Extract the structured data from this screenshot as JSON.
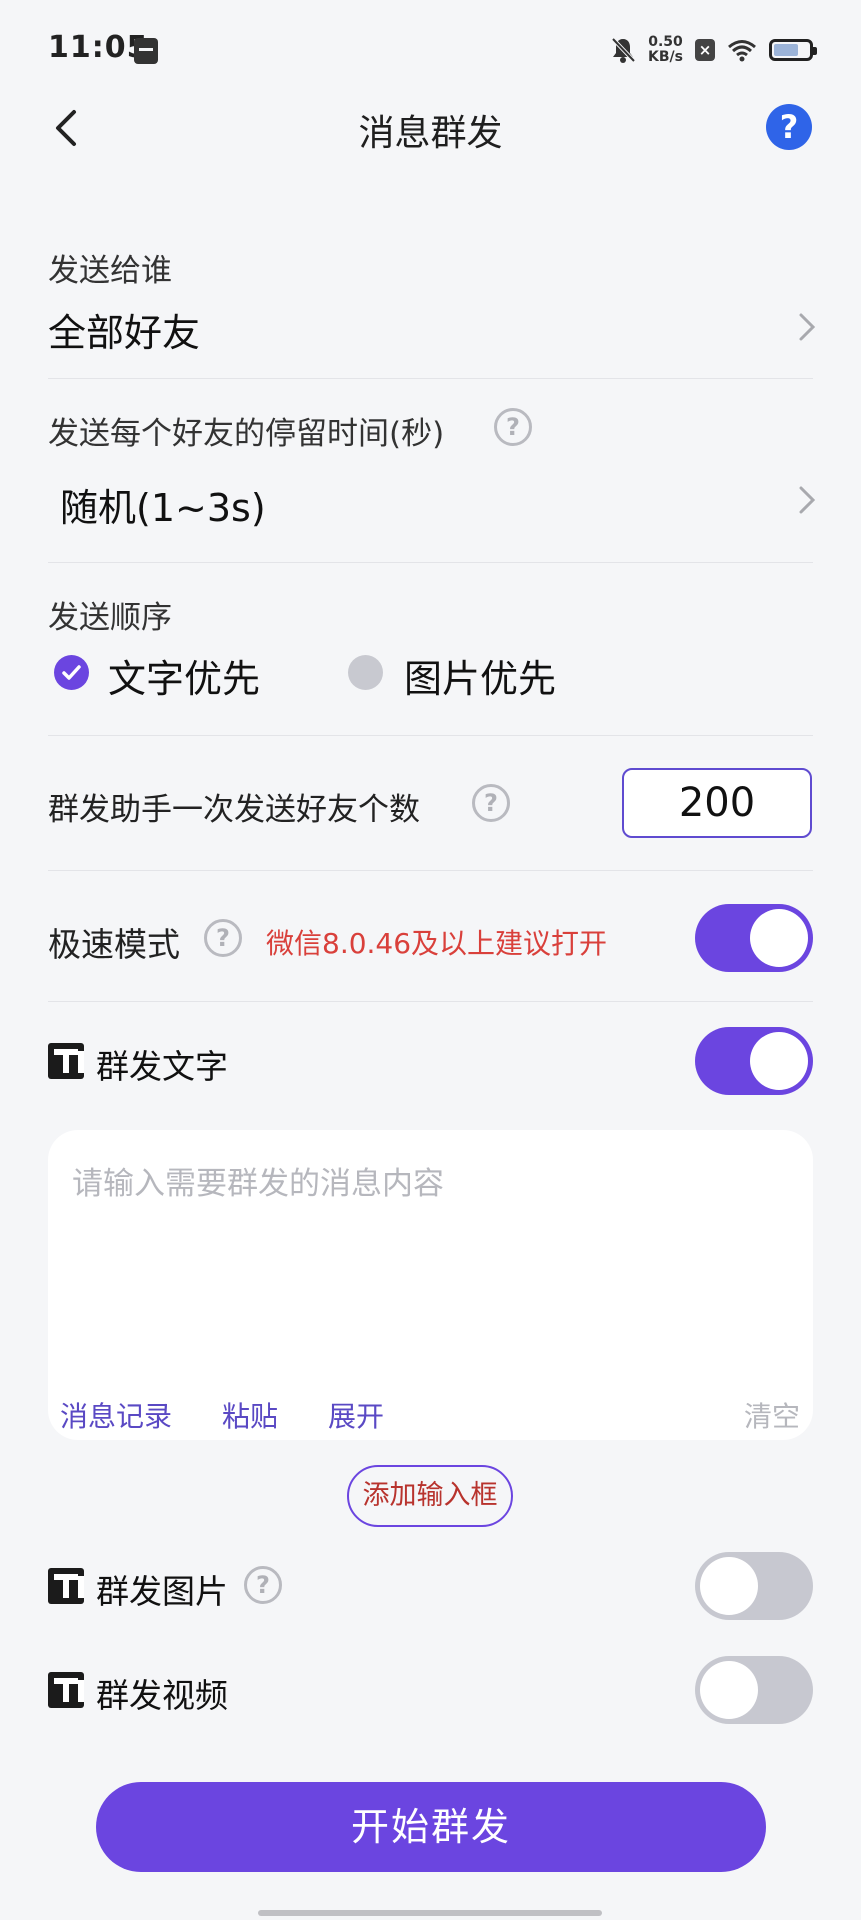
{
  "status_bar": {
    "time": "11:05",
    "net_speed_value": "0.50",
    "net_speed_unit": "KB/s",
    "icons": [
      "calendar-icon",
      "mute-bell-icon",
      "close-box-icon",
      "wifi-icon",
      "battery-icon"
    ]
  },
  "nav": {
    "title": "消息群发",
    "back_icon": "chevron-left-icon",
    "help_icon": "help-icon",
    "help_glyph": "?"
  },
  "recipients": {
    "label": "发送给谁",
    "value": "全部好友"
  },
  "dwell_time": {
    "label": "发送每个好友的停留时间(秒)",
    "value": "随机(1~3s)"
  },
  "send_order": {
    "label": "发送顺序",
    "options": [
      {
        "label": "文字优先",
        "selected": true
      },
      {
        "label": "图片优先",
        "selected": false
      }
    ]
  },
  "batch": {
    "label": "群发助手一次发送好友个数",
    "value": "200"
  },
  "speed_mode": {
    "label": "极速模式",
    "hint": "微信8.0.46及以上建议打开",
    "enabled": true
  },
  "text_section": {
    "label": "群发文字",
    "enabled": true,
    "placeholder": "请输入需要群发的消息内容",
    "actions": [
      "消息记录",
      "粘贴",
      "展开"
    ],
    "clear_label": "清空",
    "add_input_label": "添加输入框"
  },
  "image_section": {
    "label": "群发图片",
    "enabled": false
  },
  "video_section": {
    "label": "群发视频",
    "enabled": false
  },
  "start_button": "开始群发",
  "colors": {
    "accent": "#6b45e0",
    "help_blue": "#2f64e8",
    "warning": "#d9403b",
    "background": "#f5f6f8"
  }
}
